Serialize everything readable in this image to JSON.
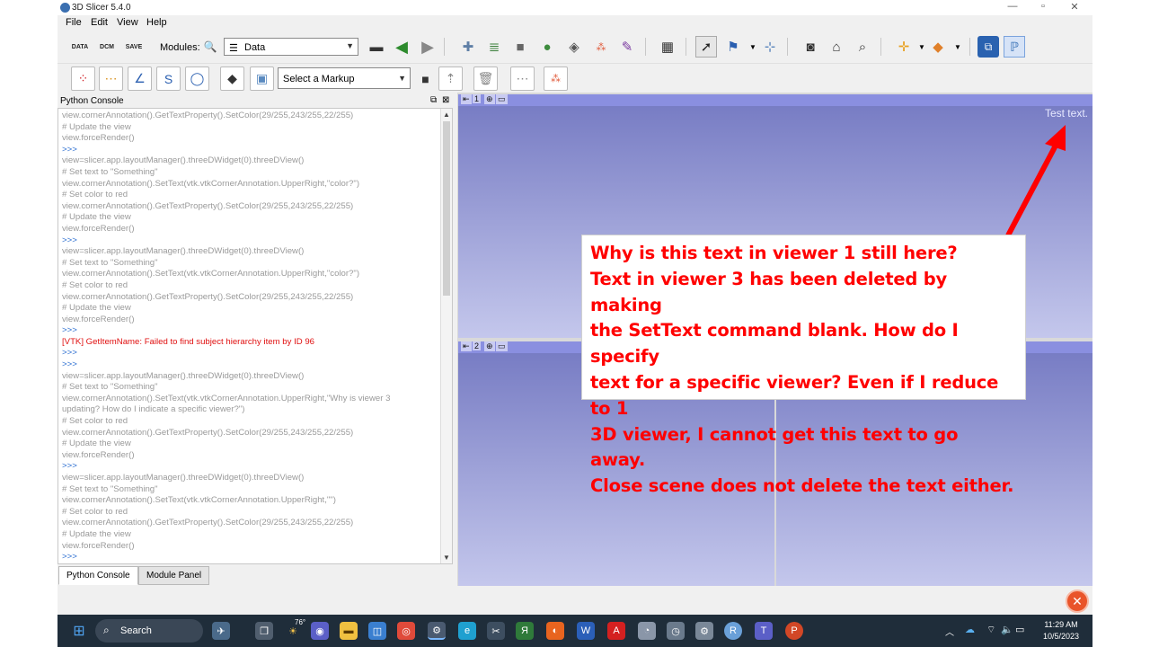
{
  "window": {
    "title": "3D Slicer 5.4.0"
  },
  "menu": [
    "File",
    "Edit",
    "View",
    "Help"
  ],
  "toolbar": {
    "data_label": "DATA",
    "dcm_label": "DCM",
    "save_label": "SAVE",
    "modules_label": "Modules:",
    "module_selected": "Data",
    "markup_selected": "Select a Markup"
  },
  "python_console": {
    "title": "Python Console",
    "lines": [
      {
        "t": "view.cornerAnnotation().GetTextProperty().SetColor(29/255,243/255,22/255)",
        "k": "grey"
      },
      {
        "t": "# Update the view",
        "k": "grey"
      },
      {
        "t": "view.forceRender()",
        "k": "grey"
      },
      {
        "t": ">>>",
        "k": "prompt"
      },
      {
        "t": "view=slicer.app.layoutManager().threeDWidget(0).threeDView()",
        "k": "grey"
      },
      {
        "t": "# Set text to \"Something\"",
        "k": "grey"
      },
      {
        "t": "view.cornerAnnotation().SetText(vtk.vtkCornerAnnotation.UpperRight,\"color?\")",
        "k": "grey"
      },
      {
        "t": "# Set color to red",
        "k": "grey"
      },
      {
        "t": "view.cornerAnnotation().GetTextProperty().SetColor(29/255,243/255,22/255)",
        "k": "grey"
      },
      {
        "t": "# Update the view",
        "k": "grey"
      },
      {
        "t": "view.forceRender()",
        "k": "grey"
      },
      {
        "t": ">>>",
        "k": "prompt"
      },
      {
        "t": "view=slicer.app.layoutManager().threeDWidget(0).threeDView()",
        "k": "grey"
      },
      {
        "t": "# Set text to \"Something\"",
        "k": "grey"
      },
      {
        "t": "view.cornerAnnotation().SetText(vtk.vtkCornerAnnotation.UpperRight,\"color?\")",
        "k": "grey"
      },
      {
        "t": "# Set color to red",
        "k": "grey"
      },
      {
        "t": "view.cornerAnnotation().GetTextProperty().SetColor(29/255,243/255,22/255)",
        "k": "grey"
      },
      {
        "t": "# Update the view",
        "k": "grey"
      },
      {
        "t": "view.forceRender()",
        "k": "grey"
      },
      {
        "t": ">>>",
        "k": "prompt"
      },
      {
        "t": "[VTK] GetItemName: Failed to find subject hierarchy item by ID 96",
        "k": "err"
      },
      {
        "t": ">>>",
        "k": "prompt"
      },
      {
        "t": ">>>",
        "k": "prompt"
      },
      {
        "t": "view=slicer.app.layoutManager().threeDWidget(0).threeDView()",
        "k": "grey"
      },
      {
        "t": "# Set text to \"Something\"",
        "k": "grey"
      },
      {
        "t": "view.cornerAnnotation().SetText(vtk.vtkCornerAnnotation.UpperRight,\"Why is viewer 3",
        "k": "grey"
      },
      {
        "t": "updating? How do I indicate a specific viewer?\")",
        "k": "grey"
      },
      {
        "t": "# Set color to red",
        "k": "grey"
      },
      {
        "t": "view.cornerAnnotation().GetTextProperty().SetColor(29/255,243/255,22/255)",
        "k": "grey"
      },
      {
        "t": "# Update the view",
        "k": "grey"
      },
      {
        "t": "view.forceRender()",
        "k": "grey"
      },
      {
        "t": ">>>",
        "k": "prompt"
      },
      {
        "t": "view=slicer.app.layoutManager().threeDWidget(0).threeDView()",
        "k": "grey"
      },
      {
        "t": "# Set text to \"Something\"",
        "k": "grey"
      },
      {
        "t": "view.cornerAnnotation().SetText(vtk.vtkCornerAnnotation.UpperRight,\"\")",
        "k": "grey"
      },
      {
        "t": "# Set color to red",
        "k": "grey"
      },
      {
        "t": "view.cornerAnnotation().GetTextProperty().SetColor(29/255,243/255,22/255)",
        "k": "grey"
      },
      {
        "t": "# Update the view",
        "k": "grey"
      },
      {
        "t": "view.forceRender()",
        "k": "grey"
      },
      {
        "t": ">>>",
        "k": "prompt"
      }
    ]
  },
  "tabs": {
    "console": "Python Console",
    "module_panel": "Module Panel"
  },
  "viewer1": {
    "number": "1",
    "corner_text": "Test text."
  },
  "viewer2": {
    "number": "2"
  },
  "annotation": {
    "lines": [
      "Why is this text in viewer 1 still here?",
      "Text in viewer 3 has been deleted by making",
      "the SetText command blank. How do I specify",
      "text for a specific viewer? Even if I reduce to 1",
      "3D viewer, I cannot get this text to go away.",
      "Close scene does not delete the text either."
    ],
    "color": "#ff0000",
    "arrow_color": "#ff0000"
  },
  "taskbar": {
    "search_label": "Search",
    "weather": "76°",
    "time": "11:29 AM",
    "date": "10/5/2023"
  },
  "colors": {
    "viewer_top": "#7479c2",
    "viewer_bottom": "#c4c7ec",
    "taskbar": "#1f2d3a"
  }
}
